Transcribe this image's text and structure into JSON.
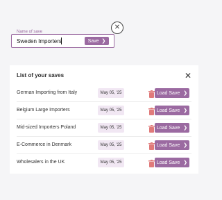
{
  "save_form": {
    "label": "Name of save",
    "value": "Sweden Importers",
    "save_label": "Save",
    "close_icon": "close-icon",
    "save_icon": "chevron-right-icon"
  },
  "panel": {
    "title": "List of your saves",
    "close_icon": "close-icon",
    "rows": [
      {
        "name": "German Importing from Italy",
        "date": "May 05, '25",
        "load_label": "Load Save"
      },
      {
        "name": "Belgium Large Importers",
        "date": "May 05, '25",
        "load_label": "Load Save"
      },
      {
        "name": "Mid-sized Importers Poland",
        "date": "May 05, '25",
        "load_label": "Load Save"
      },
      {
        "name": "E-Commerce in Denmark",
        "date": "May 05, '25",
        "load_label": "Load Save"
      },
      {
        "name": "Wholesalers in the UK",
        "date": "May 05, '25",
        "load_label": "Load Save"
      }
    ]
  },
  "colors": {
    "accent": "#9b6aa1",
    "chip_bg": "#f1e7f3",
    "trash": "#e07a7a"
  }
}
